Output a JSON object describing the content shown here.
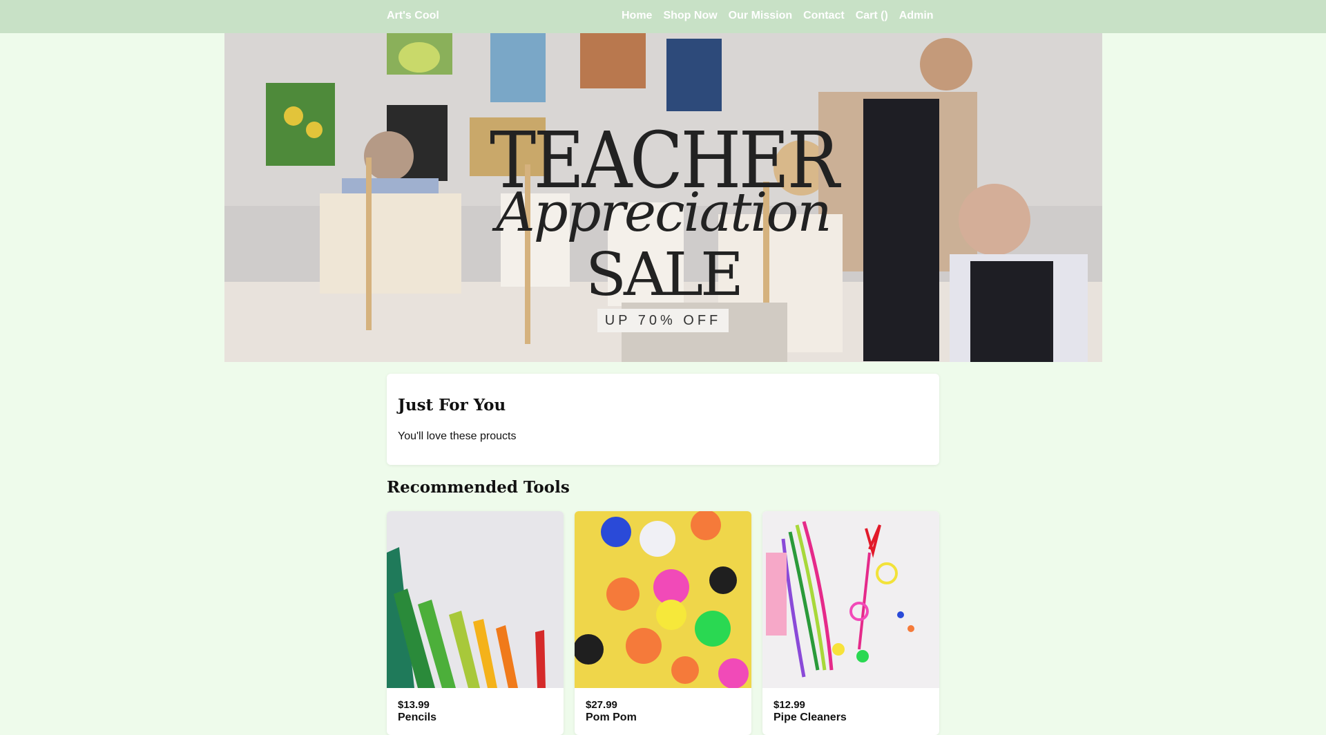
{
  "header": {
    "brand": "Art's Cool",
    "nav": [
      "Home",
      "Shop Now",
      "Our Mission",
      "Contact",
      "Cart ()",
      "Admin"
    ]
  },
  "hero": {
    "line1": "TEACHER",
    "line2": "Appreciation",
    "line3": "SALE",
    "badge": "UP 70% OFF"
  },
  "intro": {
    "title": "Just For You",
    "text": "You'll love these proucts"
  },
  "recommended": {
    "title": "Recommended Tools",
    "products": [
      {
        "price": "$13.99",
        "name": "Pencils"
      },
      {
        "price": "$27.99",
        "name": "Pom Pom"
      },
      {
        "price": "$12.99",
        "name": "Pipe Cleaners"
      }
    ]
  },
  "colors": {
    "page_bg": "#eefbeb",
    "header_bg": "#c8e1c6",
    "accent_text": "#ffffff"
  }
}
